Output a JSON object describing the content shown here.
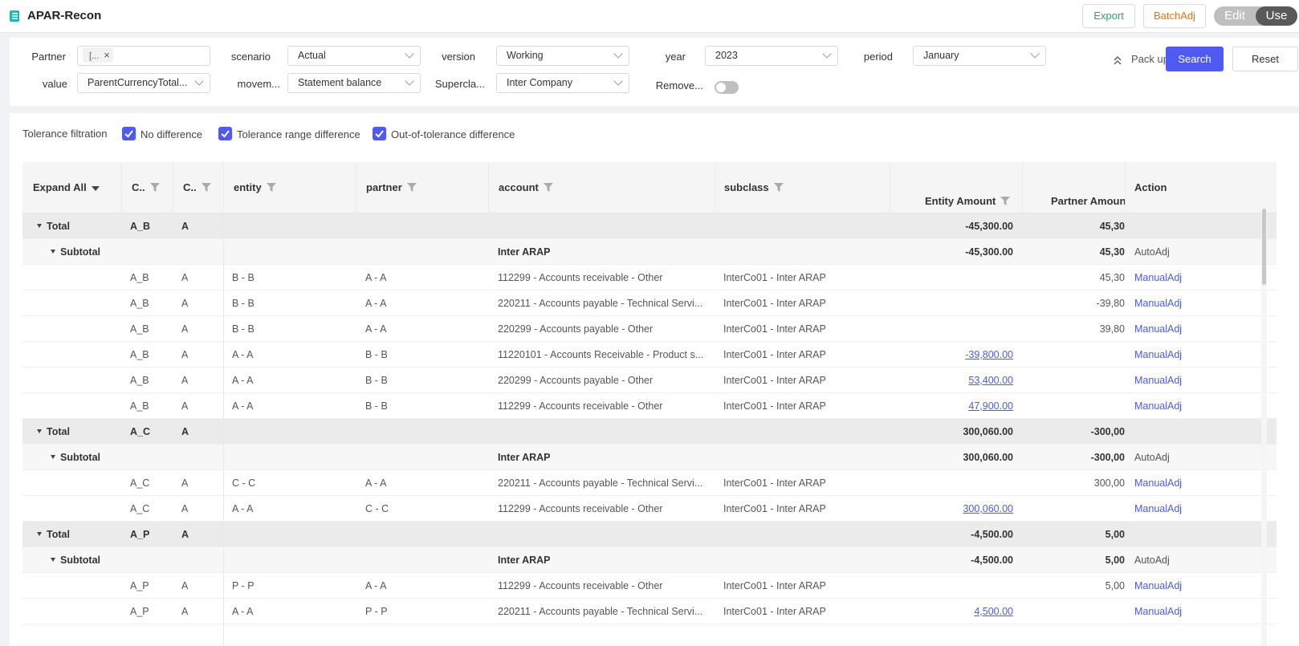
{
  "app": {
    "title": "APAR-Recon",
    "export_label": "Export",
    "batch_label": "BatchAdj",
    "edit_label": "Edit",
    "use_label": "Use"
  },
  "filters": {
    "partner": {
      "label": "Partner",
      "tag": "[...",
      "tag_close": "×"
    },
    "scenario": {
      "label": "scenario",
      "value": "Actual"
    },
    "version": {
      "label": "version",
      "value": "Working"
    },
    "year": {
      "label": "year",
      "value": "2023"
    },
    "period": {
      "label": "period",
      "value": "January"
    },
    "value": {
      "label": "value",
      "value": "ParentCurrencyTotal..."
    },
    "movement": {
      "label": "movem...",
      "value": "Statement balance"
    },
    "superclass": {
      "label": "Supercla...",
      "value": "Inter Company"
    },
    "remove": {
      "label": "Remove..."
    },
    "packup_label": "Pack up",
    "search_label": "Search",
    "reset_label": "Reset"
  },
  "tolerance": {
    "label": "Tolerance filtration",
    "options": [
      "No difference",
      "Tolerance range difference",
      "Out-of-tolerance difference"
    ]
  },
  "table": {
    "headers": {
      "expand": "Expand All",
      "c1": "C..",
      "c2": "C..",
      "entity": "entity",
      "partner": "partner",
      "account": "account",
      "subclass": "subclass",
      "entity_amount": "Entity Amount",
      "partner_amount": "Partner Amoun",
      "action": "Action"
    },
    "rows": [
      {
        "type": "total",
        "label": "Total",
        "c1": "A_B",
        "c2": "A",
        "entity_amount": "-45,300.00",
        "partner_amount": "45,30"
      },
      {
        "type": "sub",
        "label": "Subtotal",
        "account": "Inter ARAP",
        "entity_amount": "-45,300.00",
        "partner_amount": "45,30",
        "action": "AutoAdj"
      },
      {
        "type": "data",
        "c1": "A_B",
        "c2": "A",
        "entity": "B - B",
        "partner": "A - A",
        "account": "112299 - Accounts receivable - Other",
        "subclass": "InterCo01 - Inter ARAP",
        "entity_amount": "",
        "partner_amount": "45,30",
        "action": "ManualAdj"
      },
      {
        "type": "data",
        "c1": "A_B",
        "c2": "A",
        "entity": "B - B",
        "partner": "A - A",
        "account": "220211 - Accounts payable - Technical Servi...",
        "subclass": "InterCo01 - Inter ARAP",
        "entity_amount": "",
        "partner_amount": "-39,80",
        "action": "ManualAdj"
      },
      {
        "type": "data",
        "c1": "A_B",
        "c2": "A",
        "entity": "B - B",
        "partner": "A - A",
        "account": "220299 - Accounts payable - Other",
        "subclass": "InterCo01 - Inter ARAP",
        "entity_amount": "",
        "partner_amount": "39,80",
        "action": "ManualAdj"
      },
      {
        "type": "data",
        "c1": "A_B",
        "c2": "A",
        "entity": "A - A",
        "partner": "B - B",
        "account": "11220101 - Accounts Receivable - Product s...",
        "subclass": "InterCo01 - Inter ARAP",
        "entity_amount": "-39,800.00",
        "partner_amount": "",
        "action": "ManualAdj"
      },
      {
        "type": "data",
        "c1": "A_B",
        "c2": "A",
        "entity": "A - A",
        "partner": "B - B",
        "account": "220299 - Accounts payable - Other",
        "subclass": "InterCo01 - Inter ARAP",
        "entity_amount": "53,400.00",
        "partner_amount": "",
        "action": "ManualAdj"
      },
      {
        "type": "data",
        "c1": "A_B",
        "c2": "A",
        "entity": "A - A",
        "partner": "B - B",
        "account": "112299 - Accounts receivable - Other",
        "subclass": "InterCo01 - Inter ARAP",
        "entity_amount": "47,900.00",
        "partner_amount": "",
        "action": "ManualAdj"
      },
      {
        "type": "total",
        "label": "Total",
        "c1": "A_C",
        "c2": "A",
        "entity_amount": "300,060.00",
        "partner_amount": "-300,00"
      },
      {
        "type": "sub",
        "label": "Subtotal",
        "account": "Inter ARAP",
        "entity_amount": "300,060.00",
        "partner_amount": "-300,00",
        "action": "AutoAdj"
      },
      {
        "type": "data",
        "c1": "A_C",
        "c2": "A",
        "entity": "C - C",
        "partner": "A - A",
        "account": "220211 - Accounts payable - Technical Servi...",
        "subclass": "InterCo01 - Inter ARAP",
        "entity_amount": "",
        "partner_amount": "300,00",
        "action": "ManualAdj"
      },
      {
        "type": "data",
        "c1": "A_C",
        "c2": "A",
        "entity": "A - A",
        "partner": "C - C",
        "account": "112299 - Accounts receivable - Other",
        "subclass": "InterCo01 - Inter ARAP",
        "entity_amount": "300,060.00",
        "partner_amount": "",
        "action": "ManualAdj"
      },
      {
        "type": "total",
        "label": "Total",
        "c1": "A_P",
        "c2": "A",
        "entity_amount": "-4,500.00",
        "partner_amount": "5,00"
      },
      {
        "type": "sub",
        "label": "Subtotal",
        "account": "Inter ARAP",
        "entity_amount": "-4,500.00",
        "partner_amount": "5,00",
        "action": "AutoAdj"
      },
      {
        "type": "data",
        "c1": "A_P",
        "c2": "A",
        "entity": "P - P",
        "partner": "A - A",
        "account": "112299 - Accounts receivable - Other",
        "subclass": "InterCo01 - Inter ARAP",
        "entity_amount": "",
        "partner_amount": "5,00",
        "action": "ManualAdj"
      },
      {
        "type": "data",
        "c1": "A_P",
        "c2": "A",
        "entity": "A - A",
        "partner": "P - P",
        "account": "220211 - Accounts payable - Technical Servi...",
        "subclass": "InterCo01 - Inter ARAP",
        "entity_amount": "4,500.00",
        "partner_amount": "",
        "action": "ManualAdj"
      }
    ]
  }
}
